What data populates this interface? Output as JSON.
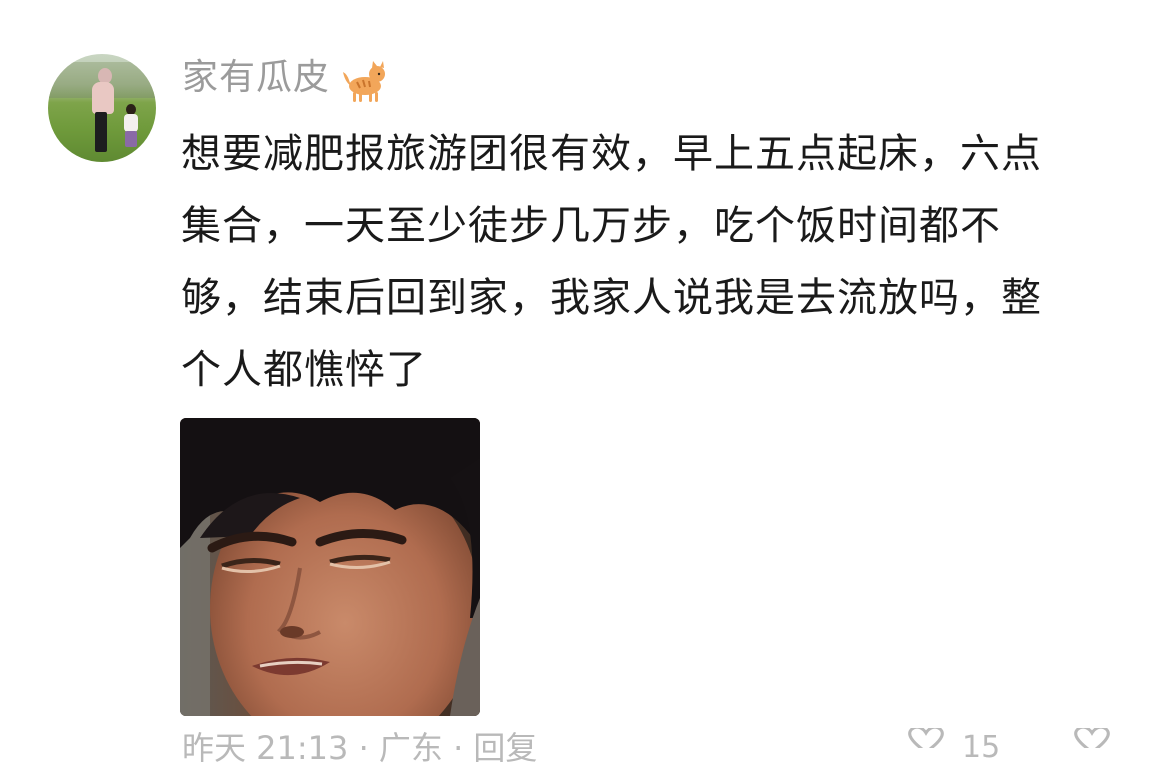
{
  "comment": {
    "username": "家有瓜皮",
    "username_badge_icon": "cat-emoji-icon",
    "content_lines": [
      "想要减肥报旅游团很有效，早上五点起床，六点",
      "集合，一天至少徒步几万步，吃个饭时间都不",
      "够，结束后回到家，我家人说我是去流放吗，整",
      "个人都憔悴了"
    ],
    "image": {
      "description_icon": "reaction-photo-tired-face"
    },
    "footer_partial": "昨天 21:13 · 广东 · 回复",
    "like_icon": "heart-icon",
    "like_count": "15",
    "more_icon": "heart-icon"
  },
  "colors": {
    "username": "#9b9b9b",
    "content": "#1a1a1a",
    "meta": "#b9b9b9",
    "background": "#ffffff"
  }
}
